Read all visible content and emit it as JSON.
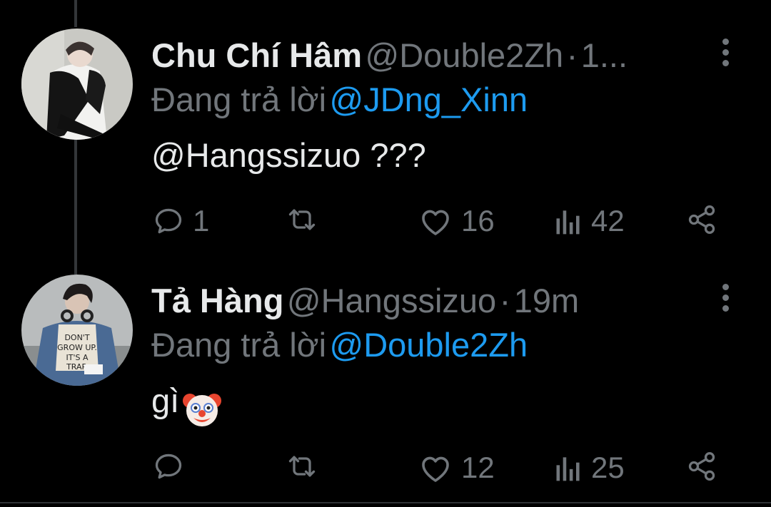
{
  "tweets": [
    {
      "display_name": "Chu Chí Hâm",
      "handle": "@Double2Zh",
      "separator": "·",
      "time": "1...",
      "replying_prefix": "Đang trả lời",
      "replying_to": "@JDng_Xinn",
      "body_mention": "@Hangssizuo",
      "body_text": " ???",
      "replies": "1",
      "retweets": "",
      "likes": "16",
      "views": "42"
    },
    {
      "display_name": "Tả Hàng",
      "handle": "@Hangssizuo",
      "separator": "·",
      "time": "19m",
      "replying_prefix": "Đang trả lời",
      "replying_to": "@Double2Zh",
      "body_mention": "",
      "body_text": "gì",
      "body_emoji": "clown-face",
      "replies": "",
      "retweets": "",
      "likes": "12",
      "views": "25"
    }
  ],
  "colors": {
    "background": "#000000",
    "text": "#e7e9ea",
    "muted": "#71767b",
    "accent": "#1d9bf0"
  },
  "icons": [
    "reply-icon",
    "retweet-icon",
    "like-icon",
    "views-icon",
    "share-icon",
    "more-icon"
  ]
}
